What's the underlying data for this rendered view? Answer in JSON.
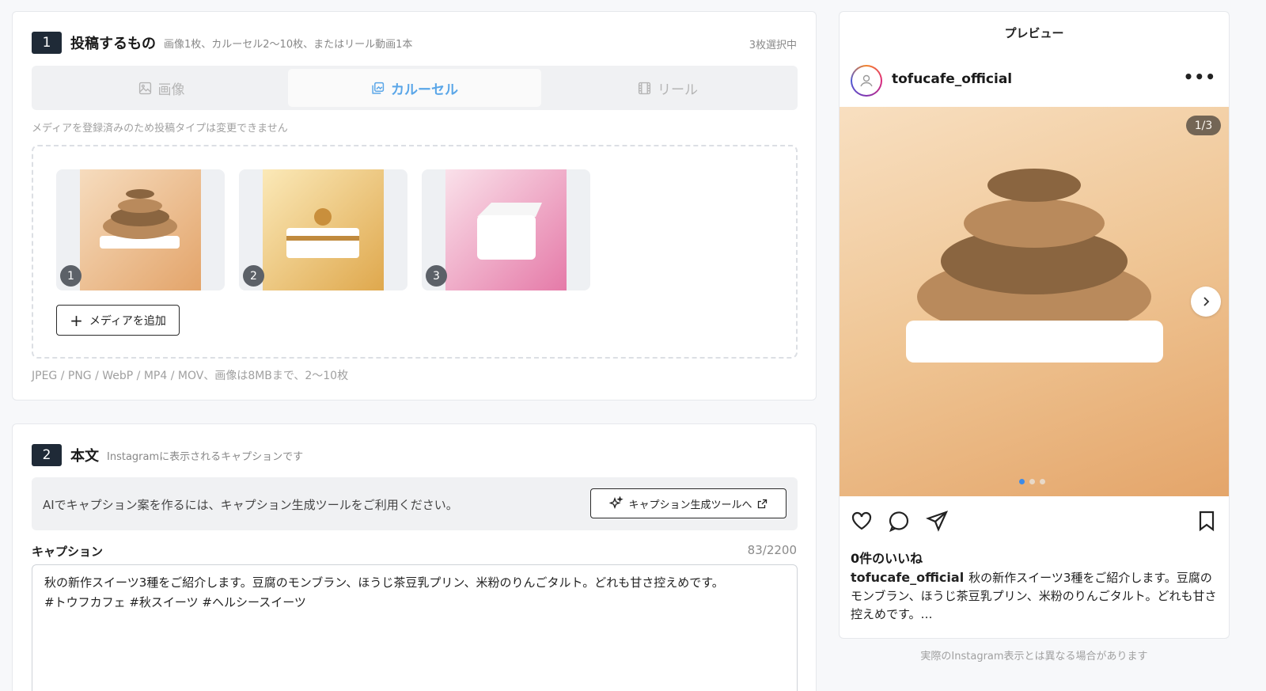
{
  "section1": {
    "number": "1",
    "title": "投稿するもの",
    "subtitle": "画像1枚、カルーセル2〜10枚、またはリール動画1本",
    "selected_count": "3枚選択中",
    "tabs": [
      {
        "label": "画像",
        "icon": "image-icon",
        "active": false
      },
      {
        "label": "カルーセル",
        "icon": "carousel-icon",
        "active": true
      },
      {
        "label": "リール",
        "icon": "film-icon",
        "active": false
      }
    ],
    "lock_hint": "メディアを登録済みのため投稿タイプは変更できません",
    "thumbnails": [
      {
        "index": "1",
        "subject": "montblanc"
      },
      {
        "index": "2",
        "subject": "pudding"
      },
      {
        "index": "3",
        "subject": "tofu"
      }
    ],
    "add_media_label": "メディアを追加",
    "format_hint": "JPEG / PNG / WebP / MP4 / MOV、画像は8MBまで、2〜10枚"
  },
  "section2": {
    "number": "2",
    "title": "本文",
    "subtitle": "Instagramに表示されるキャプションです",
    "ai_text": "AIでキャプション案を作るには、キャプション生成ツールをご利用ください。",
    "ai_button": "キャプション生成ツールへ",
    "caption_label": "キャプション",
    "caption_count": "83/2200",
    "caption_text": "秋の新作スイーツ3種をご紹介します。豆腐のモンブラン、ほうじ茶豆乳プリン、米粉のりんごタルト。どれも甘さ控えめです。\n#トウフカフェ #秋スイーツ #ヘルシースイーツ"
  },
  "preview": {
    "title": "プレビュー",
    "username": "tofucafe_official",
    "counter": "1/3",
    "likes": "0件のいいね",
    "caption_user": "tofucafe_official",
    "caption_text": "秋の新作スイーツ3種をご紹介します。豆腐のモンブラン、ほうじ茶豆乳プリン、米粉のりんごタルト。どれも甘さ控えめです。…",
    "note": "実際のInstagram表示とは異なる場合があります"
  },
  "colors": {
    "accent": "#5aa6e8",
    "badge_dark": "#1f2a37",
    "dot_active": "#3d8be8"
  }
}
